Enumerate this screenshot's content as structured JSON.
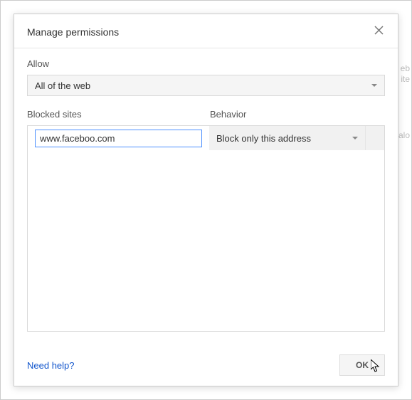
{
  "header": {
    "title": "Manage permissions"
  },
  "allow": {
    "label": "Allow",
    "selected": "All of the web"
  },
  "columns": {
    "sites": "Blocked sites",
    "behavior": "Behavior"
  },
  "row": {
    "site_value": "www.faceboo.com",
    "behavior_selected": "Block only this address"
  },
  "footer": {
    "help": "Need help?",
    "ok": "OK"
  },
  "background": {
    "t1": "eb",
    "t2": "ite",
    "t3": "alo"
  }
}
